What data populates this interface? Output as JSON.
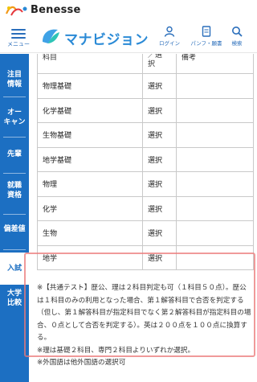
{
  "brand": {
    "name": "Benesse",
    "logo_icon": "benesse-logo-icon"
  },
  "header": {
    "menu_label": "メニュー",
    "app_name": "マナビジョン",
    "login_label": "ログイン",
    "pamphlet_label": "パンフ・願書",
    "search_label": "検索",
    "accent_color": "#2a6ebb"
  },
  "sidenav": {
    "items": [
      {
        "label": "注目\n情報"
      },
      {
        "label": "オー\nキャン"
      },
      {
        "label": "先輩"
      },
      {
        "label": "就職\n資格"
      },
      {
        "label": "偏差値"
      },
      {
        "label": "入試"
      },
      {
        "label": "大学\n比較"
      }
    ],
    "active": "入試",
    "color": "#1c6fc2"
  },
  "table": {
    "headers": [
      "科目",
      "／選\n択",
      "備考"
    ],
    "rows": [
      {
        "subject": "物理基礎",
        "select": "選択",
        "remark": ""
      },
      {
        "subject": "化学基礎",
        "select": "選択",
        "remark": ""
      },
      {
        "subject": "生物基礎",
        "select": "選択",
        "remark": ""
      },
      {
        "subject": "地学基礎",
        "select": "選択",
        "remark": ""
      },
      {
        "subject": "物理",
        "select": "選択",
        "remark": ""
      },
      {
        "subject": "化学",
        "select": "選択",
        "remark": ""
      },
      {
        "subject": "生物",
        "select": "選択",
        "remark": ""
      },
      {
        "subject": "地学",
        "select": "選択",
        "remark": ""
      }
    ]
  },
  "notes": {
    "n1": "※【共通テスト】歴公、理は２科目判定も可（１科目５０点）。歴公は１科目のみの利用となった場合、第１解答科目で合否を判定する（但し、第１解答科目が指定科目でなく第２解答科目が指定科目の場合、０点として合否を判定する）。英は２００点を１００点に換算する。",
    "n2": "※理は基礎２科目、専門２科目よりいずれか選択。",
    "n3": "※外国語は他外国語の選択可"
  }
}
